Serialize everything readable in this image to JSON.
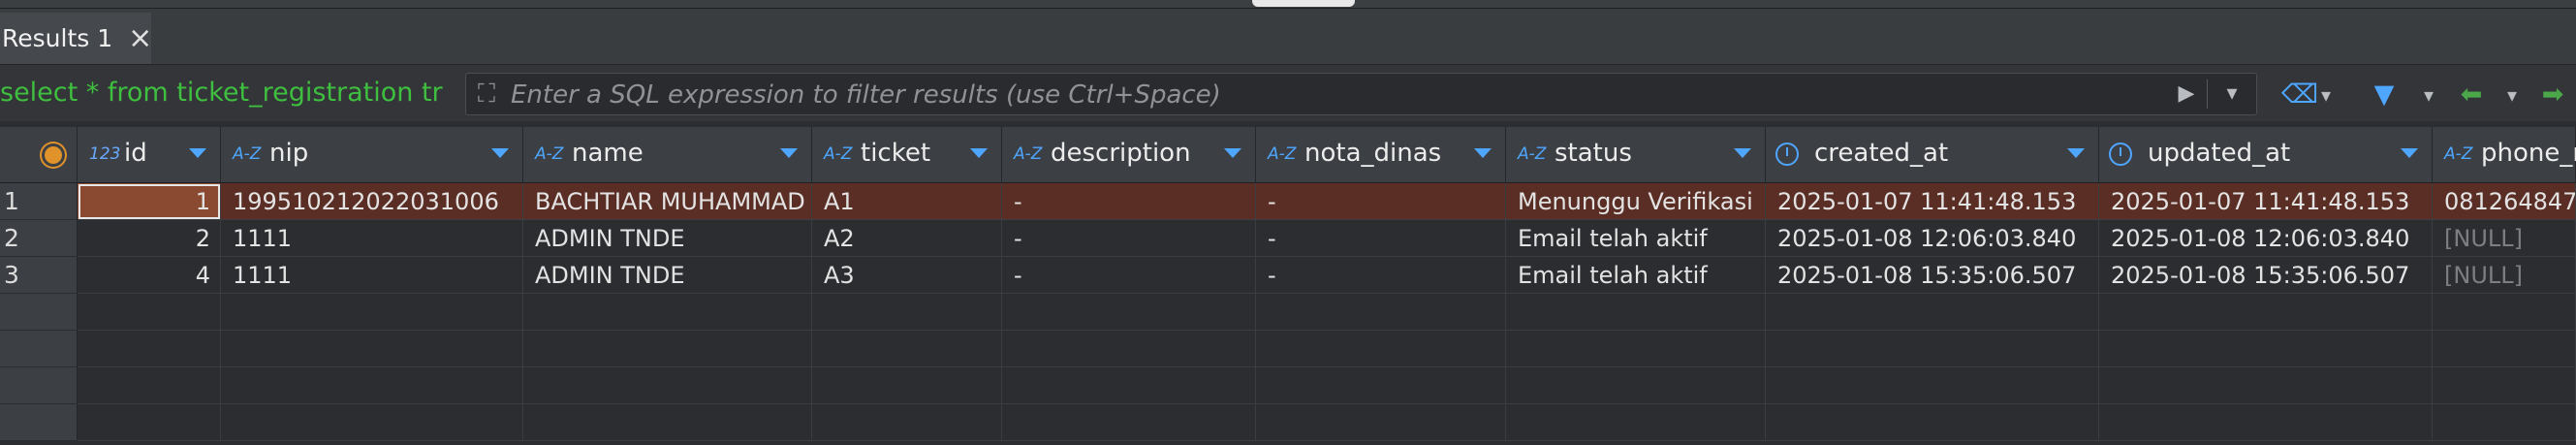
{
  "tab": {
    "label": "Results 1"
  },
  "filter": {
    "query_text": "select * from ticket_registration tr",
    "placeholder": "Enter a SQL expression to filter results (use Ctrl+Space)"
  },
  "columns": [
    {
      "key": "id",
      "label": "id",
      "type": "123"
    },
    {
      "key": "nip",
      "label": "nip",
      "type": "A-Z"
    },
    {
      "key": "name",
      "label": "name",
      "type": "A-Z"
    },
    {
      "key": "ticket",
      "label": "ticket",
      "type": "A-Z"
    },
    {
      "key": "description",
      "label": "description",
      "type": "A-Z"
    },
    {
      "key": "nota_dinas",
      "label": "nota_dinas",
      "type": "A-Z"
    },
    {
      "key": "status",
      "label": "status",
      "type": "A-Z"
    },
    {
      "key": "created_at",
      "label": "created_at",
      "type": "clock"
    },
    {
      "key": "updated_at",
      "label": "updated_at",
      "type": "clock"
    },
    {
      "key": "phone",
      "label": "phone_n",
      "type": "A-Z"
    }
  ],
  "rows": [
    {
      "num": "1",
      "id": "1",
      "nip": "199510212022031006",
      "name": "BACHTIAR MUHAMMAD",
      "ticket": "A1",
      "description": "-",
      "nota_dinas": "-",
      "status": "Menunggu Verifikasi",
      "created_at": "2025-01-07 11:41:48.153",
      "updated_at": "2025-01-07 11:41:48.153",
      "phone": "081264847"
    },
    {
      "num": "2",
      "id": "2",
      "nip": "1111",
      "name": "ADMIN TNDE",
      "ticket": "A2",
      "description": "-",
      "nota_dinas": "-",
      "status": "Email telah aktif",
      "created_at": "2025-01-08 12:06:03.840",
      "updated_at": "2025-01-08 12:06:03.840",
      "phone": "[NULL]"
    },
    {
      "num": "3",
      "id": "4",
      "nip": "1111",
      "name": "ADMIN TNDE",
      "ticket": "A3",
      "description": "-",
      "nota_dinas": "-",
      "status": "Email telah aktif",
      "created_at": "2025-01-08 15:35:06.507",
      "updated_at": "2025-01-08 15:35:06.507",
      "phone": "[NULL]"
    }
  ],
  "colors": {
    "accent": "#4ea6ff",
    "query": "#3fbf3f",
    "selected_row": "#5a2e24",
    "active_cell": "#8a4a32"
  }
}
